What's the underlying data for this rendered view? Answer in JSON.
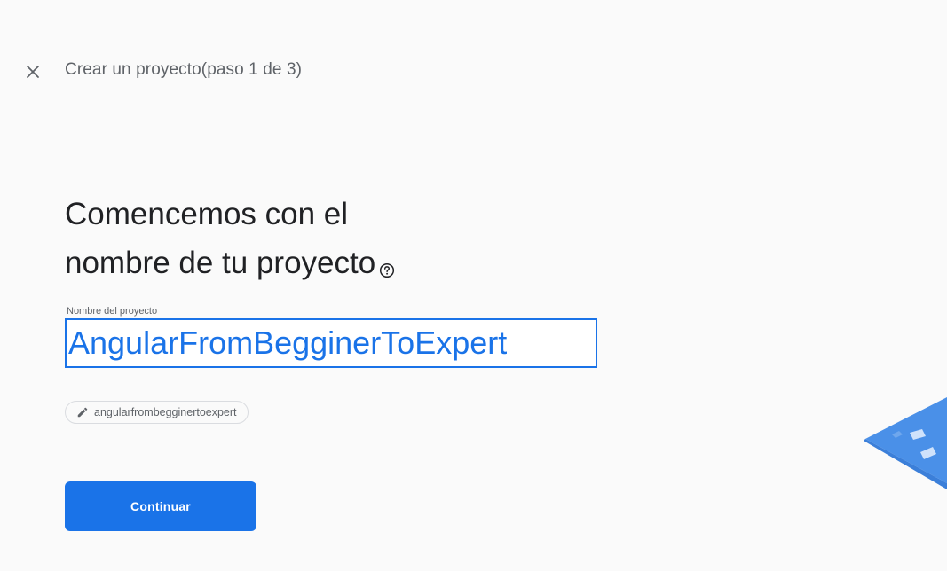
{
  "header": {
    "title": "Crear un proyecto(paso 1 de 3)",
    "close_icon": "close-icon"
  },
  "main": {
    "headline_line1": "Comencemos con el",
    "headline_line2": "nombre de tu proyecto",
    "help_icon": "help-circle-icon",
    "project_name": {
      "label": "Nombre del proyecto",
      "value": "AngularFromBegginerToExpert"
    },
    "project_id_chip": {
      "icon": "pencil-icon",
      "text": "angularfrombegginertoexpert"
    },
    "continue_label": "Continuar"
  },
  "colors": {
    "accent": "#1a73e8",
    "text_primary": "#202124",
    "text_secondary": "#5f6368",
    "background": "#fafafa"
  }
}
